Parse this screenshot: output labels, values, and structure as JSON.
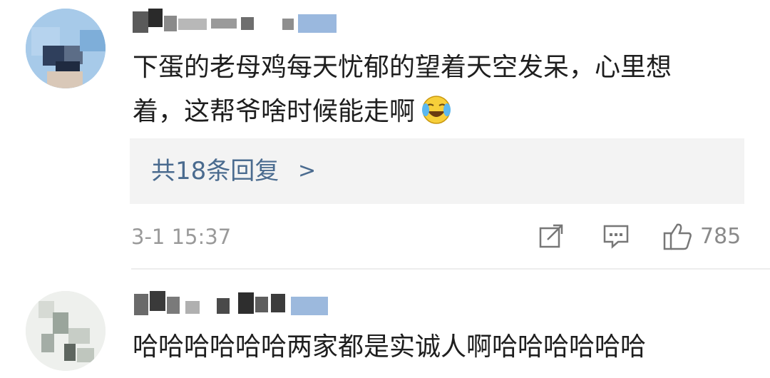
{
  "comments": [
    {
      "text_line1": "下蛋的老母鸡每天忧郁的望着天空发呆，心里想",
      "text_line2": "着，这帮爷啥时候能走啊",
      "emoji": "laugh-cry-emoji",
      "replies": {
        "label": "共18条回复",
        "arrow": ">"
      },
      "timestamp": "3-1 15:37",
      "actions": {
        "share_icon": "share-icon",
        "comment_icon": "comment-icon",
        "like_icon": "like-icon",
        "like_count": "785"
      }
    },
    {
      "text": "哈哈哈哈哈哈两家都是实诚人啊哈哈哈哈哈哈"
    }
  ],
  "colors": {
    "body_text": "#1e1e1e",
    "reply_link": "#4a6b8f",
    "meta_text": "#9a9a9a",
    "reply_bg": "#f3f3f3",
    "divider": "#ededed"
  }
}
